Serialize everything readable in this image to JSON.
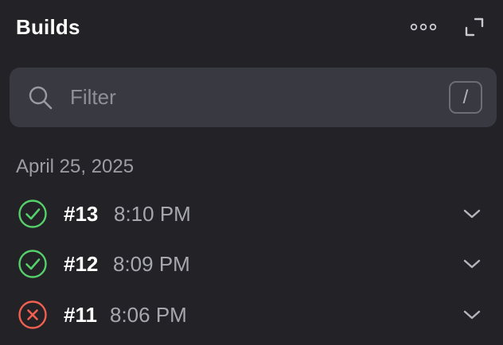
{
  "header": {
    "title": "Builds",
    "more_icon": "ellipsis-icon",
    "expand_icon": "expand-icon"
  },
  "filter": {
    "placeholder": "Filter",
    "value": "",
    "shortcut": "/",
    "icon": "search-icon"
  },
  "groups": [
    {
      "date": "April 25, 2025",
      "builds": [
        {
          "number": "#13",
          "time": "8:10 PM",
          "status": "success"
        },
        {
          "number": "#12",
          "time": "8:09 PM",
          "status": "success"
        },
        {
          "number": "#11",
          "time": "8:06 PM",
          "status": "failure"
        }
      ]
    }
  ],
  "colors": {
    "background": "#232227",
    "success": "#55d06a",
    "failure": "#f0604f"
  }
}
